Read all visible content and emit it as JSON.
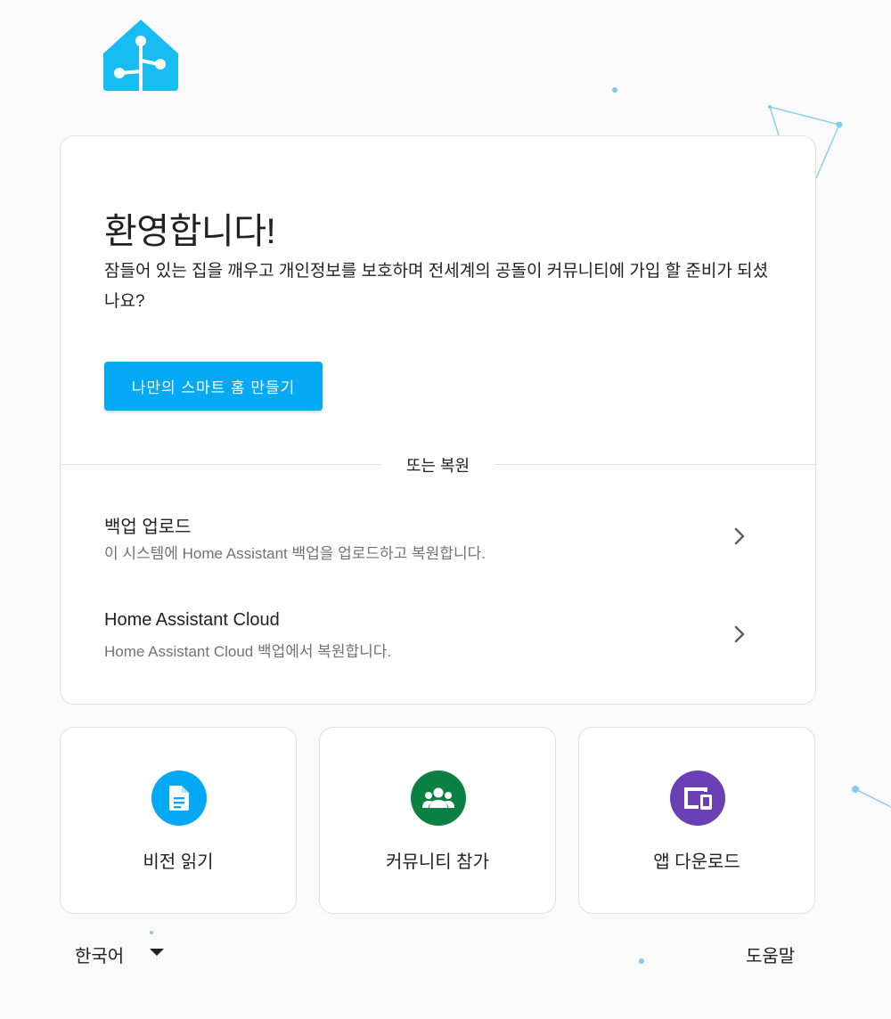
{
  "welcome": {
    "title": "환영합니다!",
    "description": "잠들어 있는 집을 깨우고 개인정보를 보호하며 전세계의 공돌이 커뮤니티에 가입 할 준비가 되셨나요?",
    "primary_button": "나만의 스마트 홈 만들기"
  },
  "restore": {
    "divider": "또는 복원",
    "items": [
      {
        "title": "백업 업로드",
        "subtitle": "이 시스템에 Home Assistant 백업을 업로드하고 복원합니다.",
        "icon": "chevron-right-icon"
      },
      {
        "title": "Home Assistant Cloud",
        "subtitle": "Home Assistant Cloud 백업에서 복원합니다.",
        "icon": "chevron-right-icon"
      }
    ]
  },
  "tiles": [
    {
      "label": "비전 읽기",
      "icon": "document-icon",
      "color": "#03a9f4"
    },
    {
      "label": "커뮤니티 참가",
      "icon": "people-group-icon",
      "color": "#0b8043"
    },
    {
      "label": "앱 다운로드",
      "icon": "devices-icon",
      "color": "#6a3fb5"
    }
  ],
  "footer": {
    "language": "한국어",
    "help": "도움말"
  },
  "colors": {
    "accent": "#03a9f4",
    "background": "#fafafa",
    "card": "#ffffff"
  }
}
